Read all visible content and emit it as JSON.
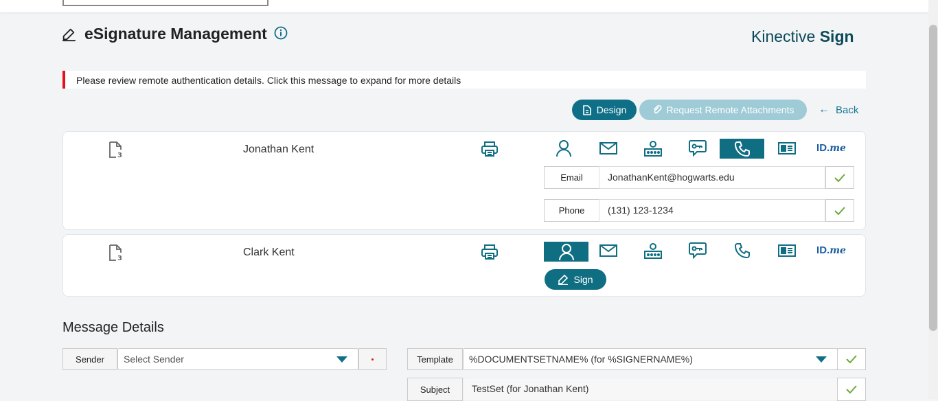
{
  "header": {
    "page_title": "eSignature Management",
    "brand_light": "Kinective",
    "brand_bold": "Sign"
  },
  "alert": {
    "message": "Please review remote authentication details. Click this message to expand for more details",
    "color": "#e5121b"
  },
  "actions": {
    "design_label": "Design",
    "request_label": "Request Remote Attachments",
    "back_label": "Back"
  },
  "signers": [
    {
      "name": "Jonathan Kent",
      "active_auth": "phone-icon",
      "fields": [
        {
          "label": "Email",
          "value": "JonathanKent@hogwarts.edu"
        },
        {
          "label": "Phone",
          "value": "(131) 123-1234"
        }
      ]
    },
    {
      "name": "Clark Kent",
      "active_auth": "person-icon",
      "sign_label": "Sign"
    }
  ],
  "auth_methods": [
    "person-icon",
    "email-icon",
    "router-icon",
    "chat-key-icon",
    "phone-icon",
    "id-card-icon",
    "idme-logo"
  ],
  "idme": {
    "id": "ID.",
    "me": "me"
  },
  "message_details": {
    "title": "Message Details",
    "sender_label": "Sender",
    "sender_placeholder": "Select Sender",
    "template_label": "Template",
    "template_value": "%DOCUMENTSETNAME% (for %SIGNERNAME%)",
    "subject_label": "Subject",
    "subject_value": "TestSet (for Jonathan Kent)"
  },
  "colors": {
    "primary": "#0f6f86",
    "disabled": "#9ecbd6",
    "check": "#6aaa3a"
  }
}
